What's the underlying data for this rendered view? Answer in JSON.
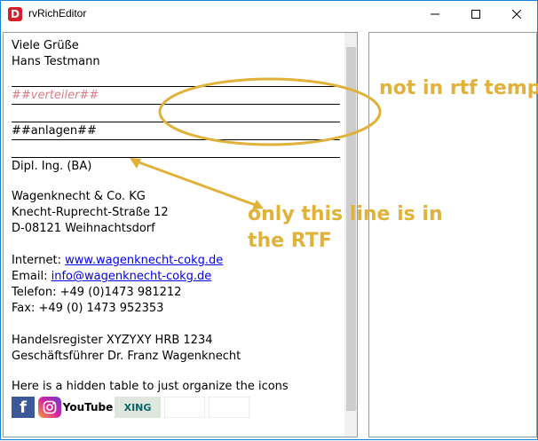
{
  "window": {
    "title": "rvRichEditor",
    "app_icon": "D",
    "buttons": {
      "minimize": "minimize-icon",
      "maximize": "maximize-icon",
      "close": "close-icon"
    }
  },
  "editor": {
    "lines": {
      "greeting": "Viele Grüße",
      "name": "Hans Testmann",
      "verteiler": "##verteiler##",
      "anlagen": "##anlagen##",
      "degree": "Dipl. Ing. (BA)",
      "company": "Wagenknecht & Co. KG",
      "street": "Knecht-Ruprecht-Straße 12",
      "city": "D-08121 Weihnachtsdorf",
      "internet_label": "Internet: ",
      "internet_link": "www.wagenknecht-cokg.de",
      "email_label": "Email: ",
      "email_link": "info@wagenknecht-cokg.de",
      "phone": "Telefon: +49 (0)1473 981212",
      "fax": "Fax: +49 (0) 1473 952353",
      "register": "Handelsregister XYZYXY HRB 1234",
      "ceo": "Geschäftsführer Dr. Franz Wagenknecht",
      "hidden_table": "Here is a hidden table to just organize the icons"
    },
    "icons": [
      "facebook-icon",
      "instagram-icon",
      "youtube-icon",
      "xing-icon"
    ],
    "youtube_text": "YouTube",
    "xing_text": "XING"
  },
  "annotations": {
    "not_in_rtf": "not in rtf temp",
    "only_line_1": "only this line is in",
    "only_line_2": "the RTF"
  },
  "colors": {
    "annotation": "#e0b23a",
    "link": "#0000ee",
    "placeholder": "#d77c86"
  }
}
